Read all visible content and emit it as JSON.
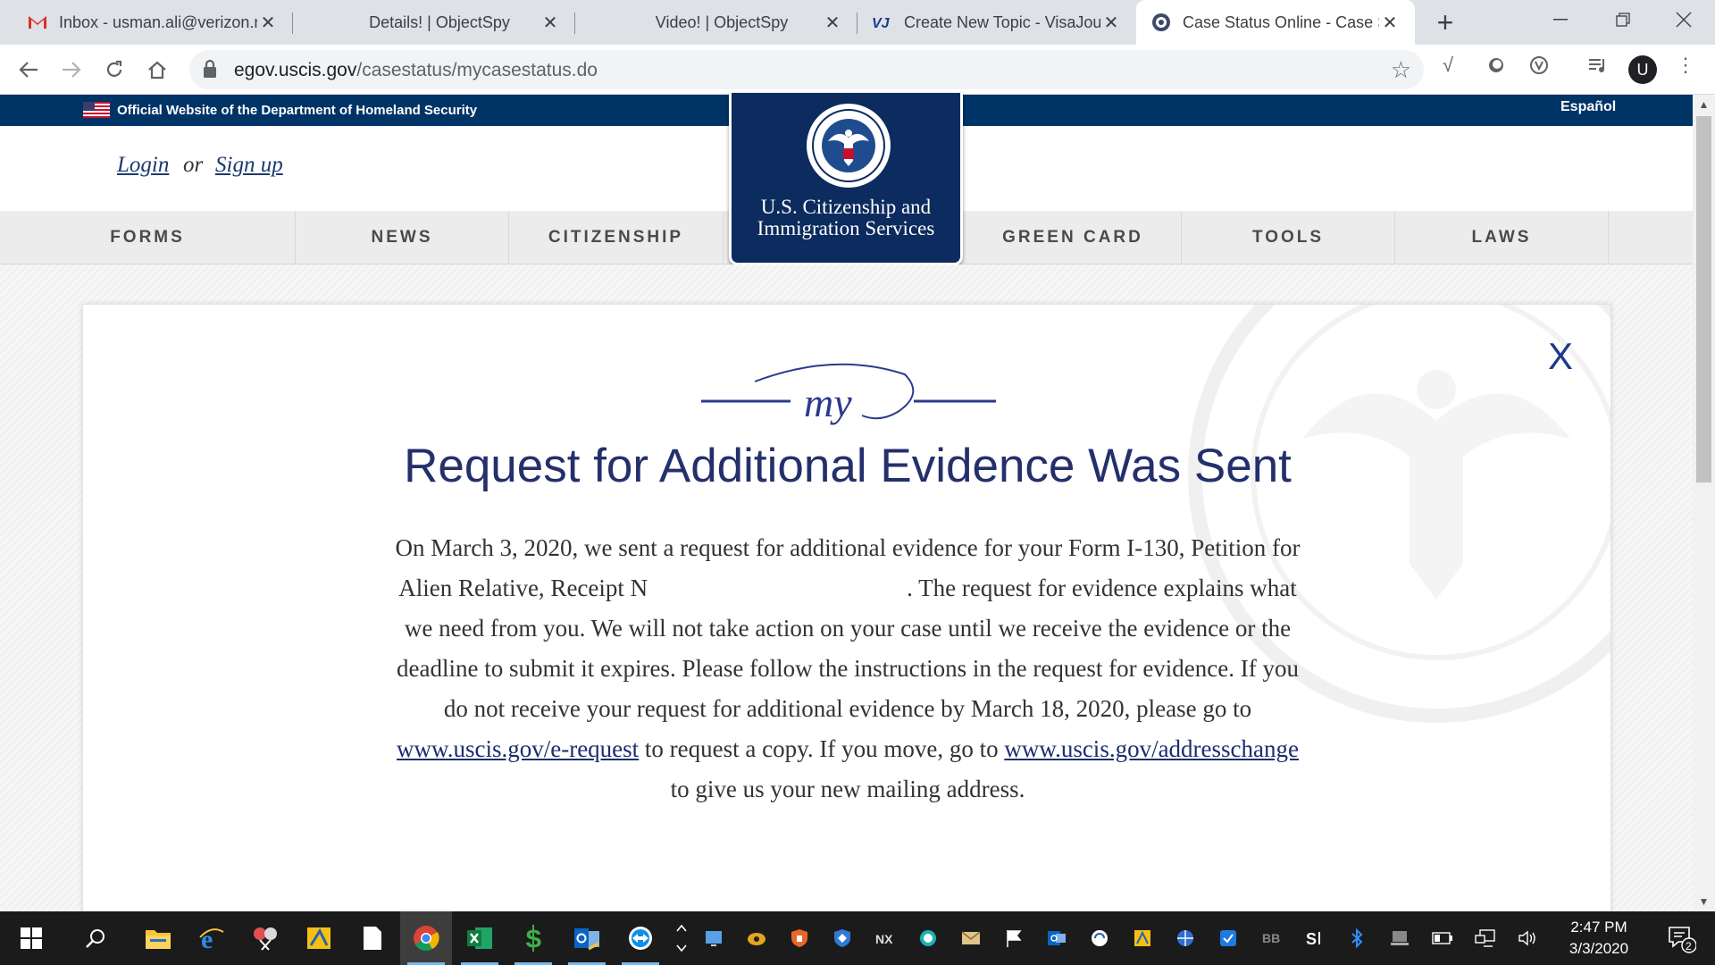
{
  "browser": {
    "tabs": [
      {
        "title": "Inbox - usman.ali@verizon.n",
        "icon": "gmail-icon"
      },
      {
        "title": "Details! | ObjectSpy",
        "icon": "blank-icon"
      },
      {
        "title": "Video! | ObjectSpy",
        "icon": "blank-icon"
      },
      {
        "title": "Create New Topic - VisaJourney",
        "icon": "visajourney-icon"
      },
      {
        "title": "Case Status Online - Case Status",
        "icon": "dhs-seal-icon"
      }
    ],
    "url_domain": "egov.uscis.gov",
    "url_path": "/casestatus/mycasestatus.do",
    "profile_initial": "U"
  },
  "site": {
    "gov_banner": "Official Website of the Department of Homeland Security",
    "language_link": "Español",
    "login": "Login",
    "or": "or",
    "signup": "Sign up",
    "agency_line1": "U.S. Citizenship and",
    "agency_line2": "Immigration Services",
    "nav": [
      "FORMS",
      "NEWS",
      "CITIZENSHIP",
      "GREEN CARD",
      "TOOLS",
      "LAWS"
    ]
  },
  "case": {
    "close": "X",
    "my_logo": "my",
    "title": "Request for Additional Evidence Was Sent",
    "body_1": "On March 3, 2020, we sent a request for additional evidence for your Form I-130, Petition for Alien Relative, Receipt N",
    "body_2": ". The request for evidence explains what we need from you. We will not take action on your case until we receive the evidence or the deadline to submit it expires. Please follow the instructions in the request for evidence. If you do not receive your request for additional evidence by March 18, 2020, please go to ",
    "link_1": "www.uscis.gov/e-request",
    "body_3": " to request a copy. If you move, go to ",
    "link_2": "www.uscis.gov/addresschange",
    "body_4": " to give us your new mailing address."
  },
  "taskbar": {
    "time": "2:47 PM",
    "date": "3/3/2020",
    "notification_count": "2"
  },
  "colors": {
    "uscis_navy": "#003366",
    "logo_navy": "#0c2b5e",
    "title_blue": "#24306b",
    "link_blue": "#1c2e6e"
  }
}
